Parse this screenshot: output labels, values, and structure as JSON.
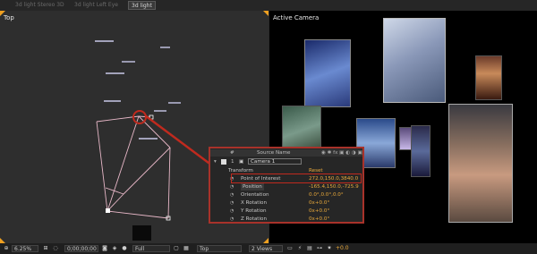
{
  "tabs": [
    "3d light Stereo 3D",
    "3d light Left Eye",
    "3d light"
  ],
  "views": {
    "top_label": "Top",
    "active_label": "Active Camera"
  },
  "layer_panel": {
    "col_hash": "#",
    "col_source": "Source Name",
    "layer_num": "1",
    "layer_name": "Camera 1",
    "group": "Transform",
    "reset": "Reset",
    "properties": [
      {
        "name": "Point of Interest",
        "value": "272.0,150.0,3840.0"
      },
      {
        "name": "Position",
        "value": "-165.4,150.0,-725.9"
      },
      {
        "name": "Orientation",
        "value": "0.0°,0.0°,0.0°"
      },
      {
        "name": "X Rotation",
        "value": "0x+0.0°"
      },
      {
        "name": "Y Rotation",
        "value": "0x+0.0°"
      },
      {
        "name": "Z Rotation",
        "value": "0x+0.0°"
      }
    ]
  },
  "bottom_bar": {
    "zoom": "6.25%",
    "timecode": "0;00;00;00",
    "resolution": "Full",
    "view_select": "Top",
    "view_layout": "2 Views",
    "exposure": "+0.0"
  },
  "colors": {
    "accent": "#a8322a",
    "value_orange": "#e9a93b",
    "corner_orange": "#f0a020"
  },
  "icons": [
    "eye-icon",
    "lock-icon",
    "camera-icon",
    "toggle-icon"
  ]
}
